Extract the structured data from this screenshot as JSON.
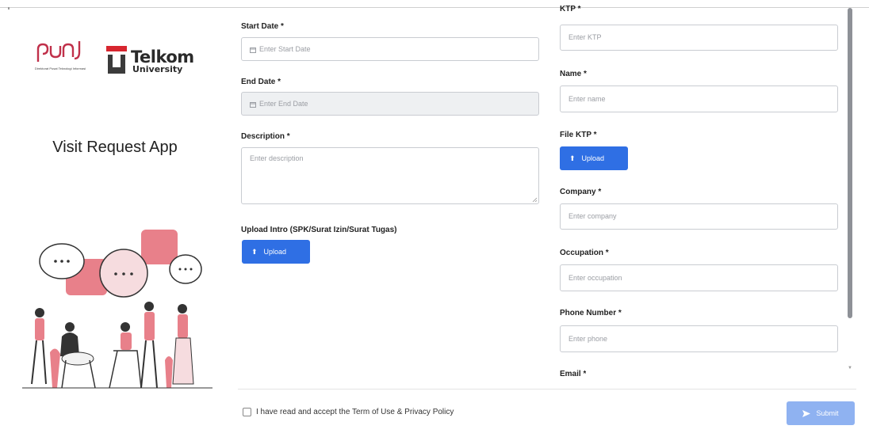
{
  "app": {
    "title": "Visit Request App",
    "logo_puni_caption": "Direktorat Pusat Teknologi Informasi",
    "logo_telkom_word": "Telkom",
    "logo_telkom_sub": "University"
  },
  "form": {
    "start_date": {
      "label": "Start Date *",
      "placeholder": "Enter Start Date"
    },
    "end_date": {
      "label": "End Date *",
      "placeholder": "Enter End Date"
    },
    "description": {
      "label": "Description *",
      "placeholder": "Enter description"
    },
    "intro_upload": {
      "label": "Upload Intro (SPK/Surat Izin/Surat Tugas)",
      "button": "Upload"
    },
    "ktp": {
      "label": "KTP *",
      "placeholder": "Enter KTP"
    },
    "name": {
      "label": "Name *",
      "placeholder": "Enter name"
    },
    "file_ktp": {
      "label": "File KTP *",
      "button": "Upload"
    },
    "company": {
      "label": "Company *",
      "placeholder": "Enter company"
    },
    "occupation": {
      "label": "Occupation *",
      "placeholder": "Enter occupation"
    },
    "phone": {
      "label": "Phone Number *",
      "placeholder": "Enter phone"
    },
    "email": {
      "label": "Email *"
    }
  },
  "footer": {
    "consent_text": "I have read and accept the Term of Use & Privacy Policy",
    "submit_label": "Submit"
  },
  "colors": {
    "primary": "#2f6fe4",
    "submit_disabled": "#8fb2f1",
    "illustration_pink": "#e8808a"
  },
  "icons": [
    "calendar-icon",
    "upload-arrow-icon",
    "send-icon"
  ]
}
